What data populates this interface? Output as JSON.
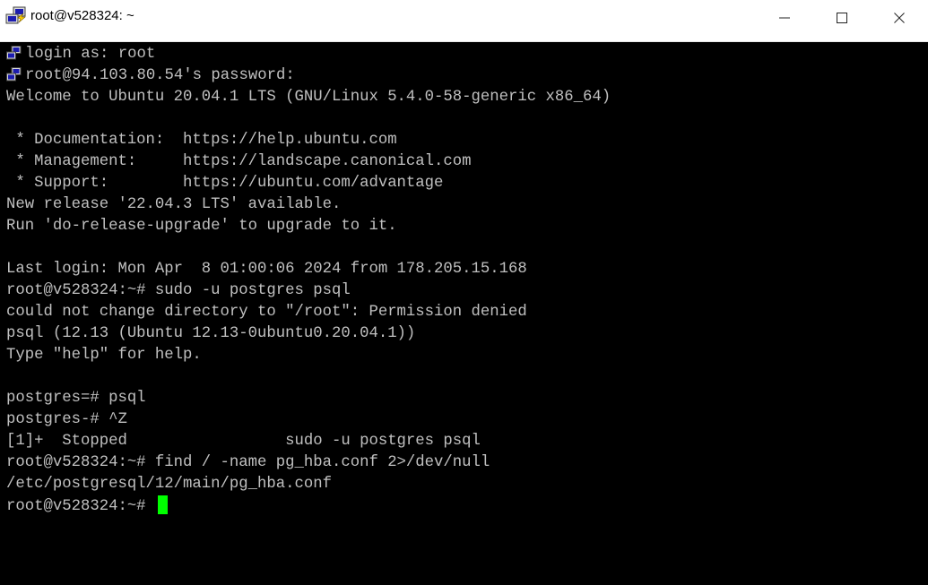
{
  "window": {
    "title": "root@v528324: ~",
    "controls": {
      "minimize_icon": "minimize-icon",
      "maximize_icon": "maximize-icon",
      "close_icon": "close-icon"
    }
  },
  "terminal": {
    "lines": [
      "login as: root",
      "root@94.103.80.54's password:",
      "Welcome to Ubuntu 20.04.1 LTS (GNU/Linux 5.4.0-58-generic x86_64)",
      "",
      " * Documentation:  https://help.ubuntu.com",
      " * Management:     https://landscape.canonical.com",
      " * Support:        https://ubuntu.com/advantage",
      "New release '22.04.3 LTS' available.",
      "Run 'do-release-upgrade' to upgrade to it.",
      "",
      "Last login: Mon Apr  8 01:00:06 2024 from 178.205.15.168",
      "root@v528324:~# sudo -u postgres psql",
      "could not change directory to \"/root\": Permission denied",
      "psql (12.13 (Ubuntu 12.13-0ubuntu0.20.04.1))",
      "Type \"help\" for help.",
      "",
      "postgres=# psql",
      "postgres-# ^Z",
      "[1]+  Stopped                 sudo -u postgres psql",
      "root@v528324:~# find / -name pg_hba.conf 2>/dev/null",
      "/etc/postgresql/12/main/pg_hba.conf",
      "root@v528324:~# "
    ],
    "cursor_color": "#00ff00",
    "text_color": "#c0c0c0",
    "background": "#000000"
  }
}
